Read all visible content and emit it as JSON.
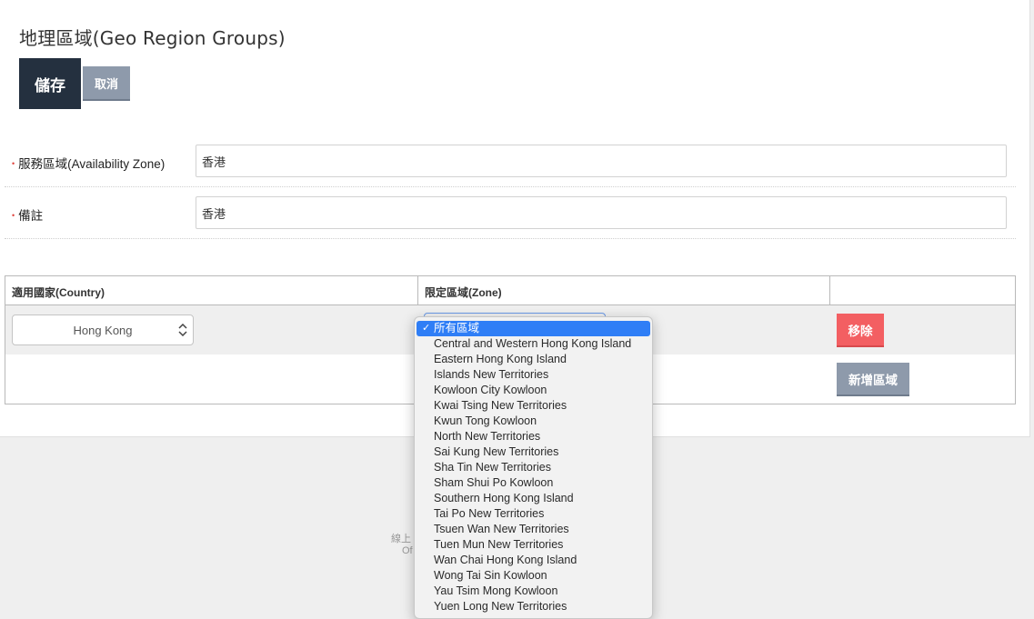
{
  "page": {
    "title": "地理區域(Geo Region Groups)"
  },
  "actions": {
    "save_label": "儲存",
    "cancel_label": "取消"
  },
  "form": {
    "availability_zone": {
      "label": "服務區域(Availability Zone)",
      "value": "香港"
    },
    "remark": {
      "label": "備註",
      "value": "香港"
    }
  },
  "table": {
    "headers": [
      "適用國家(Country)",
      "限定區域(Zone)",
      ""
    ],
    "row": {
      "country": "Hong Kong",
      "remove_label": "移除"
    },
    "add_zone_label": "新增區域"
  },
  "zone_dropdown": {
    "selected": "所有區域",
    "options": [
      "所有區域",
      "Central and Western Hong Kong Island",
      "Eastern Hong Kong Island",
      "Islands New Territories",
      "Kowloon City Kowloon",
      "Kwai Tsing New Territories",
      "Kwun Tong Kowloon",
      "North New Territories",
      "Sai Kung New Territories",
      "Sha Tin New Territories",
      "Sham Shui Po Kowloon",
      "Southern Hong Kong Island",
      "Tai Po New Territories",
      "Tsuen Wan New Territories",
      "Tuen Mun New Territories",
      "Wan Chai Hong Kong Island",
      "Wong Tai Sin Kowloon",
      "Yau Tsim Mong Kowloon",
      "Yuen Long New Territories"
    ]
  },
  "footer": {
    "line1": "線上",
    "line2": "Of"
  },
  "colors": {
    "save": "#24303f",
    "secondary": "#8e9aab",
    "danger": "#f35f62",
    "highlight": "#2f7ef6"
  }
}
